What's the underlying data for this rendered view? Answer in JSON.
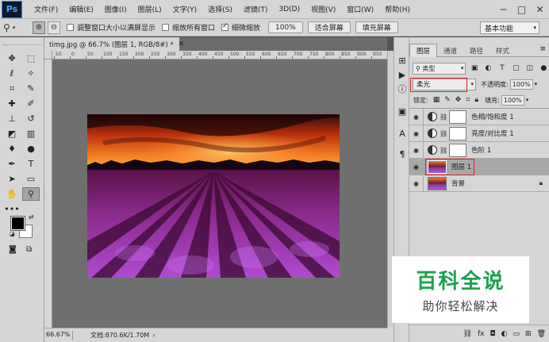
{
  "app": {
    "logo": "Ps"
  },
  "menu": [
    "文件(F)",
    "编辑(E)",
    "图像(I)",
    "图层(L)",
    "文字(Y)",
    "选择(S)",
    "滤镜(T)",
    "3D(D)",
    "视图(V)",
    "窗口(W)",
    "帮助(H)"
  ],
  "options": {
    "resize_windows": "调整窗口大小以满屏显示",
    "zoom_all": "缩放所有窗口",
    "scrubby_zoom": "细微缩放",
    "zoom_100": "100%",
    "fit_screen": "适合屏幕",
    "fill_screen": "填充屏幕",
    "workspace": "基本功能"
  },
  "document": {
    "tab_title": "timg.jpg @ 66.7% (图层 1, RGB/8#) *",
    "ruler_ticks": [
      "50",
      "0",
      "50",
      "100",
      "150",
      "200",
      "250",
      "300",
      "350",
      "400",
      "450",
      "500",
      "550",
      "600",
      "650",
      "700",
      "750",
      "800",
      "850",
      "900",
      "950"
    ]
  },
  "status": {
    "zoom": "66.67%",
    "doc_info": "文档:870.6K/1.70M"
  },
  "layers_panel": {
    "tabs": [
      "图层",
      "通道",
      "路径",
      "样式"
    ],
    "filter_kind": "类型",
    "blend_mode": "柔光",
    "opacity_label": "不透明度:",
    "opacity_value": "100%",
    "lock_label": "锁定:",
    "fill_label": "填充:",
    "fill_value": "100%",
    "layers": [
      {
        "name": "色相/饱和度 1",
        "type": "adjustment"
      },
      {
        "name": "亮度/对比度 1",
        "type": "adjustment"
      },
      {
        "name": "色阶 1",
        "type": "adjustment"
      },
      {
        "name": "图层 1",
        "type": "image",
        "selected": true
      },
      {
        "name": "背景",
        "type": "image",
        "locked": true
      }
    ]
  },
  "watermark": {
    "title": "百科全说",
    "subtitle": "助你轻松解决"
  }
}
